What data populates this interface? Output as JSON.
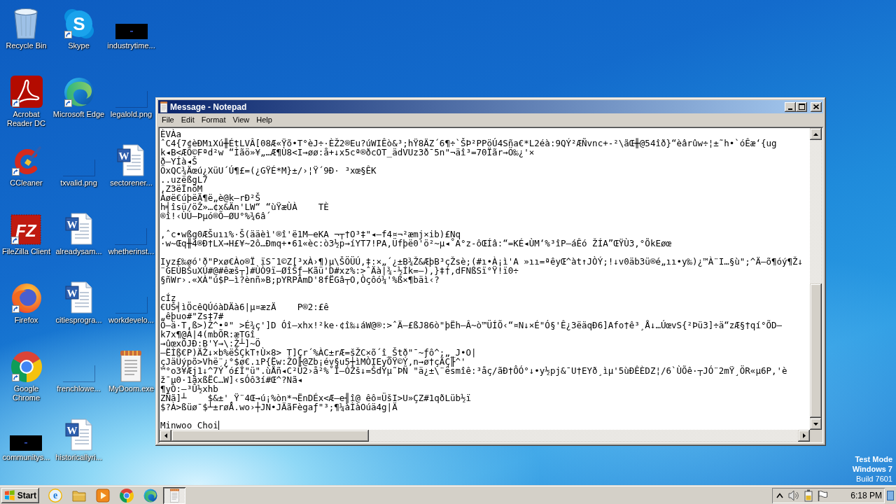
{
  "desktop": {
    "icons": [
      {
        "label": "Recycle Bin",
        "kind": "recycle-bin",
        "shortcut": false
      },
      {
        "label": "Acrobat Reader DC",
        "kind": "acrobat",
        "shortcut": true
      },
      {
        "label": "CCleaner",
        "kind": "ccleaner",
        "shortcut": true
      },
      {
        "label": "FileZilla Client",
        "kind": "filezilla",
        "shortcut": true,
        "glyph": "FZ"
      },
      {
        "label": "Firefox",
        "kind": "firefox",
        "shortcut": true
      },
      {
        "label": "Google Chrome",
        "kind": "chrome",
        "shortcut": true
      },
      {
        "label": "communitys...",
        "kind": "dark-thumbnail",
        "shortcut": false
      },
      {
        "label": "Skype",
        "kind": "skype",
        "shortcut": true,
        "glyph": "S"
      },
      {
        "label": "Microsoft Edge",
        "kind": "edge",
        "shortcut": true
      },
      {
        "label": "txvalid.png",
        "kind": "blank-thumbnail",
        "shortcut": false
      },
      {
        "label": "alreadysam...",
        "kind": "word-doc",
        "shortcut": false,
        "glyph": "W"
      },
      {
        "label": "citiesprogra...",
        "kind": "word-doc",
        "shortcut": false,
        "glyph": "W"
      },
      {
        "label": "frenchlowe...",
        "kind": "blank-thumbnail",
        "shortcut": false
      },
      {
        "label": "historicallyri...",
        "kind": "word-doc",
        "shortcut": false,
        "glyph": "W"
      },
      {
        "label": "industrytime...",
        "kind": "dark-thumbnail",
        "shortcut": false
      },
      {
        "label": "legalold.png",
        "kind": "blank-thumbnail",
        "shortcut": false
      },
      {
        "label": "sectorener...",
        "kind": "word-doc",
        "shortcut": false,
        "glyph": "W"
      },
      {
        "label": "whetherinst...",
        "kind": "blank-thumbnail",
        "shortcut": false
      },
      {
        "label": "workdevelo...",
        "kind": "blank-thumbnail",
        "shortcut": false
      },
      {
        "label": "MyDoom.exe",
        "kind": "notepad-exe",
        "shortcut": false
      }
    ],
    "os_notice": {
      "mode": "Test Mode",
      "version": "Windows 7",
      "build": "Build 7601"
    }
  },
  "notepad": {
    "title": "Message - Notepad",
    "menu": [
      "File",
      "Edit",
      "Format",
      "View",
      "Help"
    ],
    "blocks": [
      [
        "ÈVÀa",
        "ˆC4{7¢èÐMıXú╫ÉtLVÂ[08Æ«Ÿõ•T°èJ÷·ÈŽ2®Eu?úWIÊò&³;hŸ8ÄZ´6¶÷`ŠÞ²PPöÚ4Sña€*L2éà:9QÝ²ÆÑvnc+-²\\ãŒ╫@54îð}“èârûw÷¦±˜h•`óÊæ‘{ug",
        "k◂B<ÆÕ©Fªd²w “Ìãö»¥„…Æ¶Ù8<I→øø:å+↓x5cª®ðcOT_ädVUz3ð¯5n\"¬äî³=70Ïãr→Ö‰¿'×",
        "ð–YÍà◂Š",
        "ÖxQC¾Äœú¿XüU´Ú¶£=(¿GŸÉ*M}±/›¦Ÿ´9Ð· ³xœ§ÊK",
        "..uzëßgL7",
        ",Z3ëÏnöM",
        "Àøë€úþëÄ¶ë„è@k–rÐ²Š",
        "h╡îsü/öŽ»…¢x&Än'LW“ “ùŸæÙÀ    TÈ",
        "®î!‹ÙÚ–Þµó®Õ–ØU°%¾6â´"
      ],
      [
        ",ˆc•wßg0ÆŠuıı%·Š(ääèì'®î'ë1M–eKA ¬┬†O³‡\"◂–f4¤¬²æmj×ib)£Nq",
        "·w~Œq╫4®Ð†LX→H£¥~2ô…Ðmq+•61«èc:ò3½p→íYT7!PA,Üfþë0'ö²~µ◂˚A°z-ôŒÍâ:“=KÉ◂ÙM‘%³îP–áÊó ŽÍA”ŒŸÙ3,°ÕkEøœ"
      ],
      [
        "Iyz£‰øó'ð\"Pxø€Ào®Ï ïS¯1©Z[³xÀ›¶)µ\\ŠÖÜÚ,‡:×„´¿±B¾Ž&ÆþB³çŽsè;(#ı•À¡ì'A »ıı=ªêyŒ^àt↑JÒÝ;!↓v0äb3ü®é„ıı•y‰)¿™À¨I…§ù\";^Ä–õ¶óý¶Ž↓",
        "¨GEÙBŠuXÚ#@#êæš┬]#ÙÒ9ï–ØîŠƒ–Kãü'D#xz%:>ˆÄà|¾-½Ík=–),}‡†,dFNßSï°Ÿ!ï0÷",
        "§ñWr›.«XÀ\"ú$P–ì?ènñ»B;pYRPÂmD'8fËGâ┬O,Òçôó¼'%ß×¶bäì‹?"
      ],
      [
        "cÍz",
        "€UŠ╡ìÖcêQÚóàDÄà6|µ¤æzÄ    P®2:£ê",
        "„êþuo#\"Zs‡7#",
        "Õ–ä·T,ß>)Ž^•ª\" >É¾ç']D Óî–xhx!²ke·¢î‰↓áW@®:>ˆÄ–£ßJ86ò\"þËh–Â~ò™ÜÍÕ‹“¤N↓×É\"Ó§'Ê¿3ëäqÐ6]Afo†ê³¸Å↓…ÚœvS{²Þü3]÷ä“zÆ§†qí°ÕD–",
        "k7x¶@Á|4(mbÕR:æTGî",
        "→ûœxÕJÐ:B'Y→\\:Ž┴]~Ö",
        "–ËÌß€P)ÄŽ↓×b%ëŠÇkT↑Ù×8> T]Çr´%ÀC±rÆ=šŽC×õ´î_Štð\"¯~ƒô^;„_J•O|",
        "çJäÜýpõ>Vhë¨¿°$ø€.ıP{Ëw:ŽO╟@Zb¡év§u5┼ìMÒIEyÕŸ©Ý,n→ø†çÄÇ╟^'",
        "™°o3¥Æj1↓^7Ý´ó£Î\"ü\".ùÅñ◂C²Ü2›å²%˚Ï–ÓŽš↓=ŠdÝµ˜ÞÑ \"ä¿±\\¨ësmîê:³åç/ãÐ†ÔÓ°↓•y½pj&¯U†EYð¸ìµ'5ùÐÊÈDZ¦/6`ÙÕê·┬JÓ¨2mŸ¸ÖR«µ6P,'è",
        "ž¯µ0·1ãxßËC…W]‹sÓô3í#Œ^?Nã◂",
        "¶yÒ:–³Û½xhb",
        "ZÑã]┴    $&±'¸Ÿ¨4Œ→ú¡%òn*¬ËnDÉx<Æ–e╢î@ êô¤ÜšI>U»ÇZ#1qðLüb½ï",
        "$?À>ßüø¯$┴±røÅ.wo›┼JN•JÄãFègaƒ\"³;¶¼àÌàOúä4g|Ä"
      ],
      [
        "Minwoo Choi"
      ]
    ],
    "caret": true
  },
  "taskbar": {
    "start": "Start",
    "buttons": [
      {
        "kind": "ie",
        "glyph": "e",
        "selected": false
      },
      {
        "kind": "explorer",
        "selected": false
      },
      {
        "kind": "media-player",
        "selected": false
      },
      {
        "kind": "chrome",
        "selected": false
      },
      {
        "kind": "edge",
        "selected": false
      },
      {
        "kind": "notepad",
        "selected": true
      }
    ],
    "tray": {
      "icons": [
        {
          "kind": "chevron"
        },
        {
          "kind": "speaker"
        },
        {
          "kind": "power"
        },
        {
          "kind": "flag"
        }
      ],
      "time": "6:18 PM"
    }
  }
}
